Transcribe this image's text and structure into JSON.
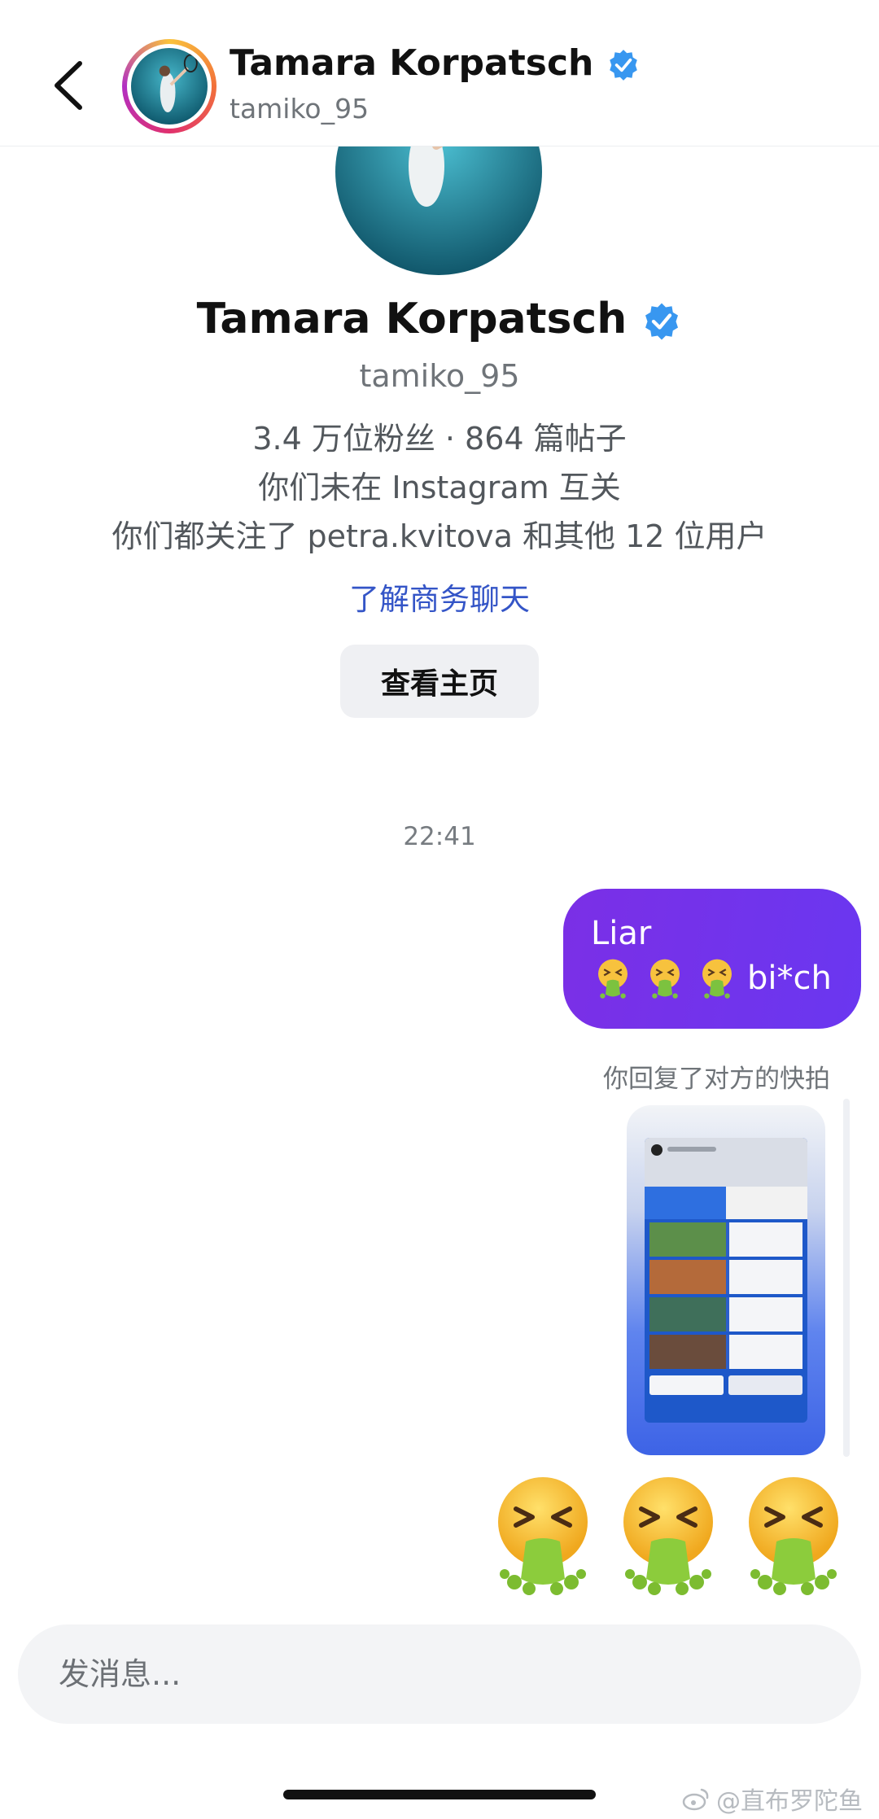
{
  "header": {
    "back_icon": "chevron-left-icon",
    "name": "Tamara Korpatsch",
    "handle": "tamiko_95",
    "verified_color": "#3897f0"
  },
  "profile": {
    "name": "Tamara Korpatsch",
    "handle": "tamiko_95",
    "stats": "3.4 万位粉丝 · 864 篇帖子",
    "mutual_status": "你们未在 Instagram 互关",
    "mutual_follows": "你们都关注了 petra.kvitova 和其他 12 位用户",
    "business_link": "了解商务聊天",
    "view_profile_label": "查看主页"
  },
  "chat": {
    "timestamp": "22:41",
    "message": {
      "line1": "Liar",
      "line2_text": "bi*ch",
      "emoji_name": "vomiting-face-icon",
      "emoji_count": 3
    },
    "reply_note": "你回复了对方的快拍",
    "big_emoji_count": 3
  },
  "composer": {
    "placeholder": "发消息..."
  },
  "watermark": "@直布罗陀鱼",
  "colors": {
    "bubble": "#7433ea",
    "link": "#3455c7",
    "verified": "#3897f0"
  }
}
